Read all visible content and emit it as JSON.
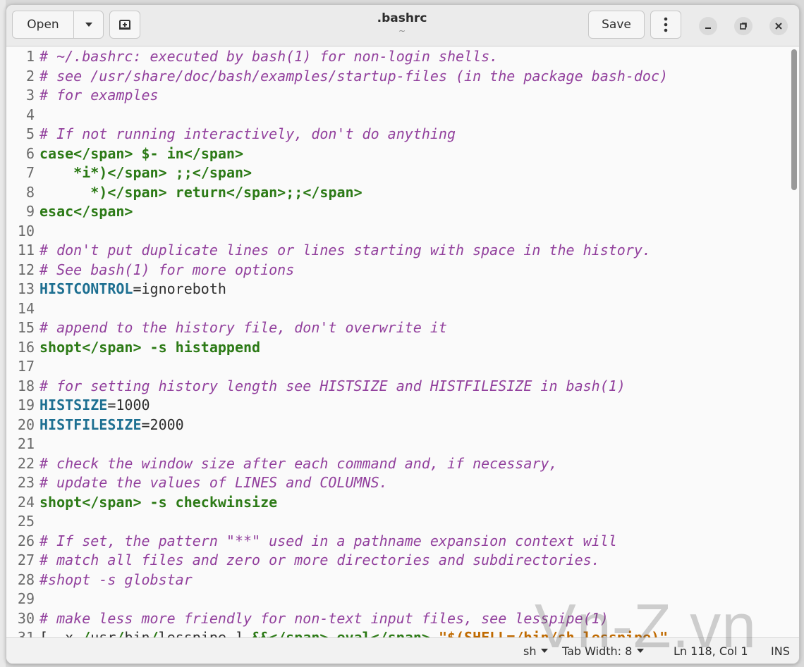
{
  "header": {
    "open_label": "Open",
    "save_label": "Save",
    "title": ".bashrc",
    "subtitle": "~"
  },
  "icons": {
    "open_dropdown": "chevron-down-icon",
    "new_tab": "new-tab-icon",
    "menu": "kebab-menu-icon",
    "minimize": "minimize-icon",
    "maximize": "restore-icon",
    "close": "close-icon"
  },
  "lines": [
    {
      "n": "1",
      "t": "# ~/.bashrc: executed by bash(1) for non-login shells."
    },
    {
      "n": "2",
      "t": "# see /usr/share/doc/bash/examples/startup-files (in the package bash-doc)"
    },
    {
      "n": "3",
      "t": "# for examples"
    },
    {
      "n": "4",
      "t": ""
    },
    {
      "n": "5",
      "t": "# If not running interactively, don't do anything"
    },
    {
      "n": "6",
      "t": "case $- in"
    },
    {
      "n": "7",
      "t": "    *i*) ;;"
    },
    {
      "n": "8",
      "t": "      *) return;;"
    },
    {
      "n": "9",
      "t": "esac"
    },
    {
      "n": "10",
      "t": ""
    },
    {
      "n": "11",
      "t": "# don't put duplicate lines or lines starting with space in the history."
    },
    {
      "n": "12",
      "t": "# See bash(1) for more options"
    },
    {
      "n": "13",
      "t": "HISTCONTROL=ignoreboth"
    },
    {
      "n": "14",
      "t": ""
    },
    {
      "n": "15",
      "t": "# append to the history file, don't overwrite it"
    },
    {
      "n": "16",
      "t": "shopt -s histappend"
    },
    {
      "n": "17",
      "t": ""
    },
    {
      "n": "18",
      "t": "# for setting history length see HISTSIZE and HISTFILESIZE in bash(1)"
    },
    {
      "n": "19",
      "t": "HISTSIZE=1000"
    },
    {
      "n": "20",
      "t": "HISTFILESIZE=2000"
    },
    {
      "n": "21",
      "t": ""
    },
    {
      "n": "22",
      "t": "# check the window size after each command and, if necessary,"
    },
    {
      "n": "23",
      "t": "# update the values of LINES and COLUMNS."
    },
    {
      "n": "24",
      "t": "shopt -s checkwinsize"
    },
    {
      "n": "25",
      "t": ""
    },
    {
      "n": "26",
      "t": "# If set, the pattern \"**\" used in a pathname expansion context will"
    },
    {
      "n": "27",
      "t": "# match all files and zero or more directories and subdirectories."
    },
    {
      "n": "28",
      "t": "#shopt -s globstar"
    },
    {
      "n": "29",
      "t": ""
    },
    {
      "n": "30",
      "t": "# make less more friendly for non-text input files, see lesspipe(1)"
    },
    {
      "n": "31",
      "t": "[ -x /usr/bin/lesspipe ] && eval \"$(SHELL=/bin/sh lesspipe)\""
    }
  ],
  "status": {
    "language": "sh",
    "tab_width": "Tab Width: 8",
    "position": "Ln 118, Col 1",
    "mode": "INS"
  },
  "watermark": "Vn-Z.vn",
  "colors": {
    "comment": "#92409d",
    "keyword": "#2c7a16",
    "variable": "#1d6f91",
    "string": "#c06a00"
  }
}
